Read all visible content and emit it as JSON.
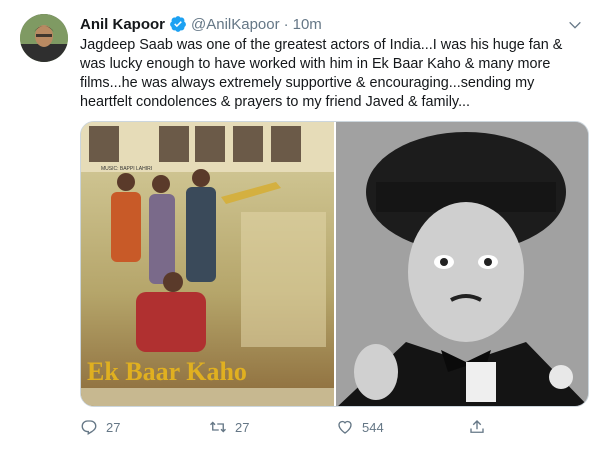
{
  "author": {
    "display_name": "Anil Kapoor",
    "handle": "@AnilKapoor",
    "separator": "·",
    "timestamp": "10m",
    "verified": true
  },
  "tweet_text": "Jagdeep Saab was one of the greatest actors of India...I was his huge fan & was lucky enough to have worked with him in Ek Baar Kaho & many more films...he was always extremely supportive & encouraging...sending my heartfelt condolences & prayers to my friend Javed & family...",
  "media": [
    {
      "kind": "album-cover",
      "album_title": "Ek Baar Kaho",
      "credit": "MUSIC: BAPPI LAHIRI"
    },
    {
      "kind": "photo"
    }
  ],
  "actions": {
    "reply_count": "27",
    "retweet_count": "27",
    "like_count": "544"
  },
  "colors": {
    "text": "#14171a",
    "muted": "#657786",
    "verified_blue": "#1da1f2",
    "border": "#ccd6dd"
  },
  "icons": [
    "reply-icon",
    "retweet-icon",
    "like-icon",
    "share-icon",
    "caret-down-icon",
    "verified-badge-icon"
  ]
}
